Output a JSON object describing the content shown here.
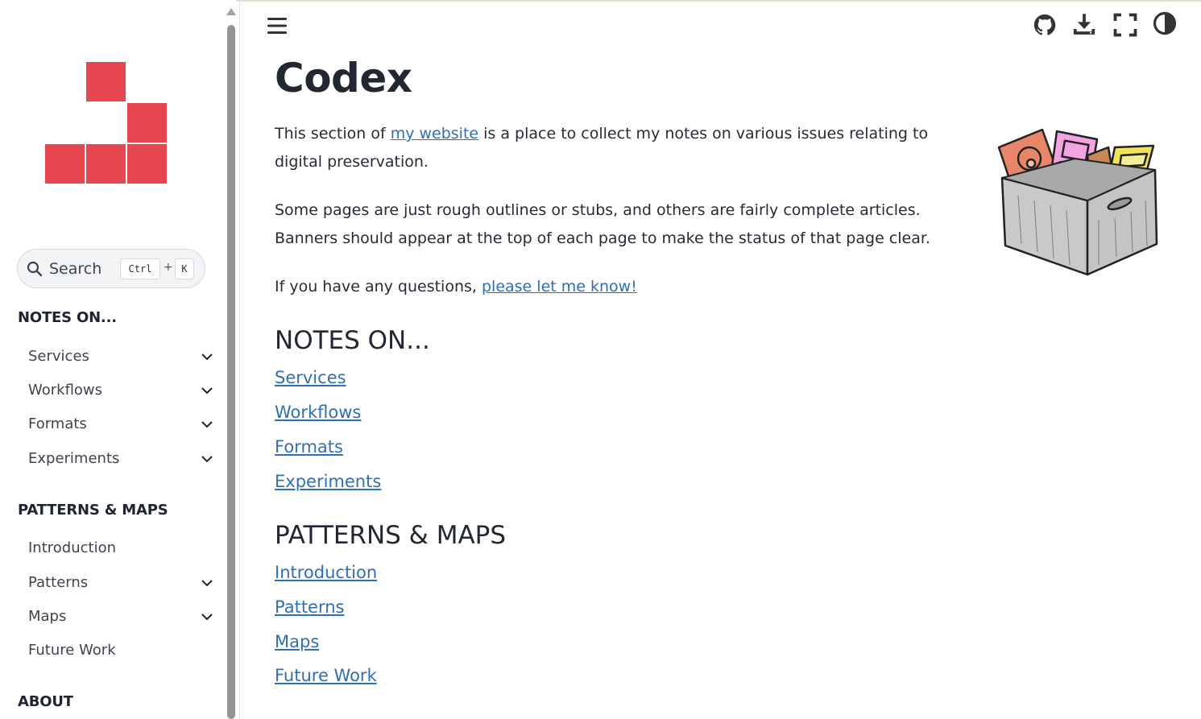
{
  "sidebar": {
    "search": {
      "label": "Search",
      "shortcut_ctrl": "Ctrl",
      "shortcut_plus": "+",
      "shortcut_key": "K"
    },
    "sections": [
      {
        "title": "NOTES ON...",
        "items": [
          {
            "label": "Services",
            "expandable": true
          },
          {
            "label": "Workflows",
            "expandable": true
          },
          {
            "label": "Formats",
            "expandable": true
          },
          {
            "label": "Experiments",
            "expandable": true
          }
        ]
      },
      {
        "title": "PATTERNS & MAPS",
        "items": [
          {
            "label": "Introduction",
            "expandable": false
          },
          {
            "label": "Patterns",
            "expandable": true
          },
          {
            "label": "Maps",
            "expandable": true
          },
          {
            "label": "Future Work",
            "expandable": false
          }
        ]
      },
      {
        "title": "ABOUT",
        "items": []
      }
    ]
  },
  "header": {
    "icons": [
      "menu-icon",
      "github-icon",
      "download-icon",
      "fullscreen-icon",
      "theme-toggle-icon"
    ]
  },
  "main": {
    "title": "Codex",
    "para1": {
      "before": "This section of ",
      "link": "my website",
      "after": " is a place to collect my notes on various issues relating to digital preservation."
    },
    "para2": "Some pages are just rough outlines or stubs, and others are fairly complete articles. Banners should appear at the top of each page to make the status of that page clear.",
    "para3": {
      "before": "If you have any questions, ",
      "link": "please let me know!"
    },
    "notes_heading": "NOTES ON...",
    "notes_links": [
      "Services",
      "Workflows",
      "Formats",
      "Experiments"
    ],
    "patterns_heading": "PATTERNS & MAPS",
    "patterns_links": [
      "Introduction",
      "Patterns",
      "Maps",
      "Future Work"
    ]
  },
  "colors": {
    "logo_red": "#e5464f",
    "link_blue": "#2f6fb3",
    "text": "#222832"
  }
}
